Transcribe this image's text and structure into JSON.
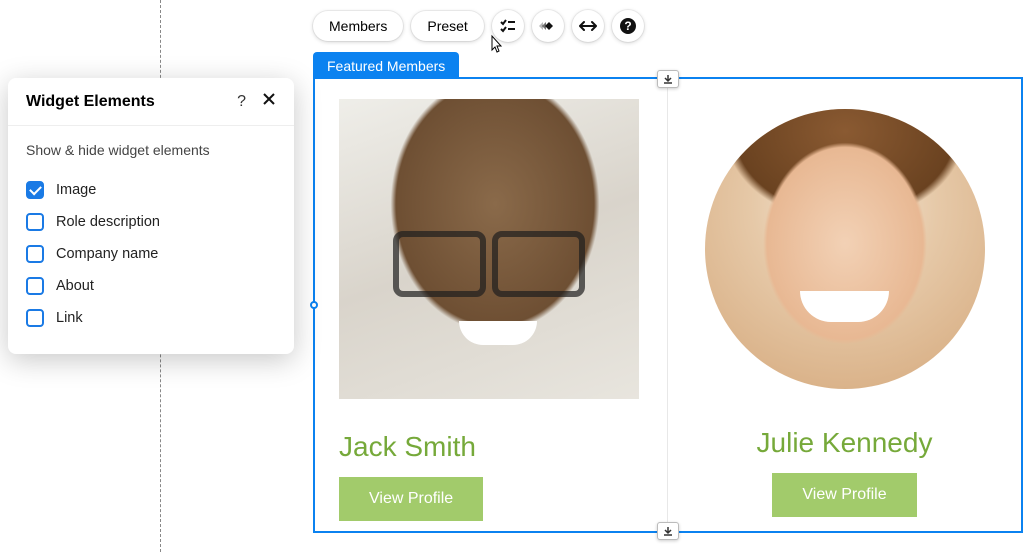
{
  "toolbar": {
    "members_label": "Members",
    "preset_label": "Preset"
  },
  "widget_tag": "Featured Members",
  "members": [
    {
      "name": "Jack Smith",
      "button": "View Profile"
    },
    {
      "name": "Julie Kennedy",
      "button": "View Profile"
    }
  ],
  "panel": {
    "title": "Widget Elements",
    "description": "Show & hide widget elements",
    "help_glyph": "?",
    "options": [
      {
        "label": "Image",
        "checked": true
      },
      {
        "label": "Role description",
        "checked": false
      },
      {
        "label": "Company name",
        "checked": false
      },
      {
        "label": "About",
        "checked": false
      },
      {
        "label": "Link",
        "checked": false
      }
    ]
  }
}
